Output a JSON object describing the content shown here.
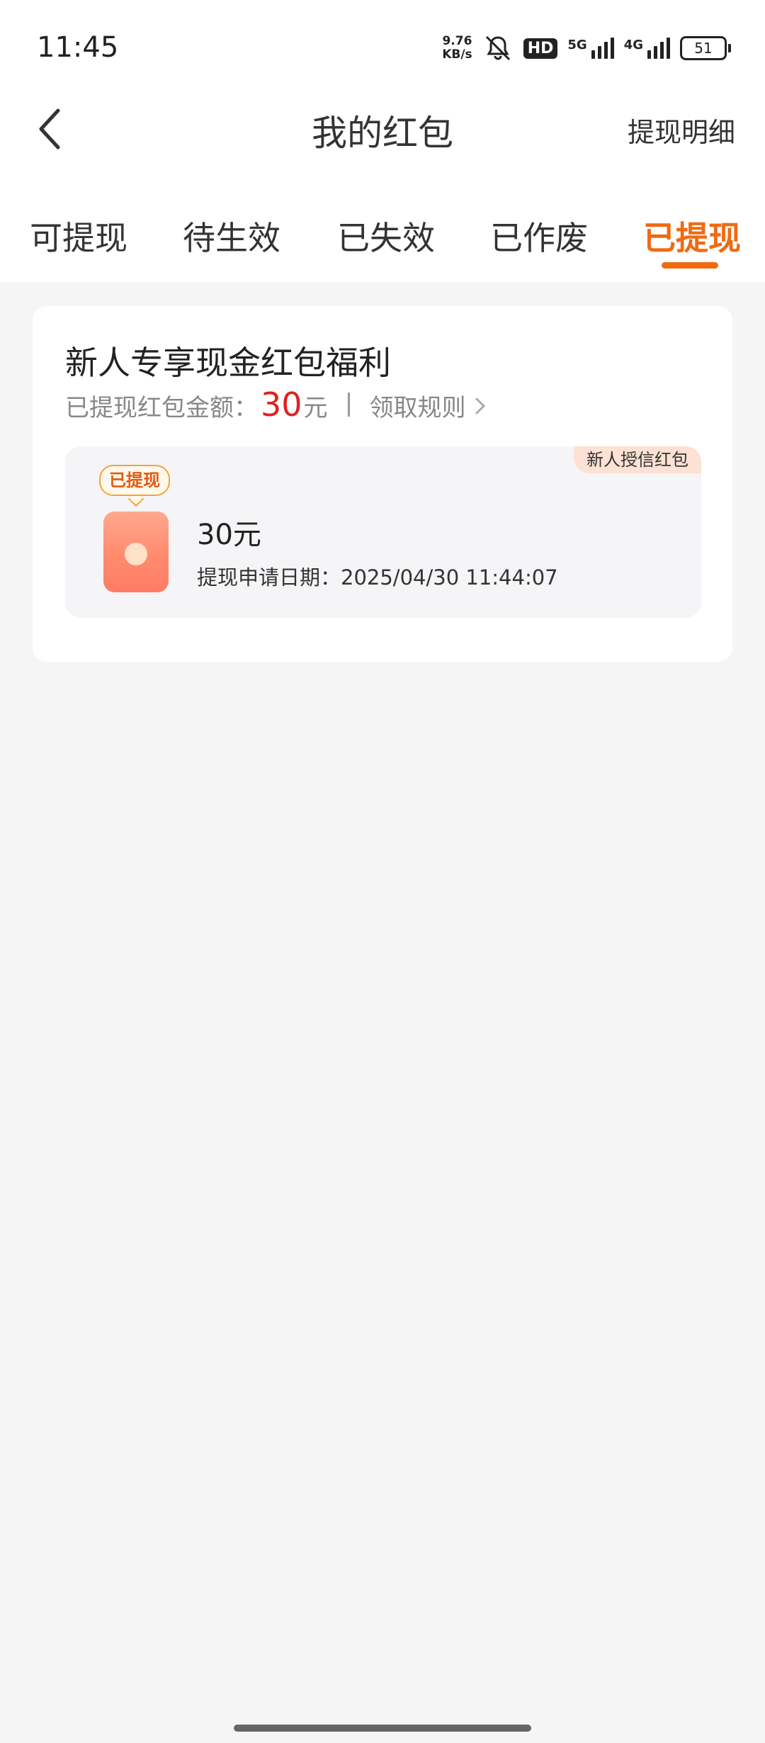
{
  "status_bar": {
    "time": "11:45",
    "net_speed_value": "9.76",
    "net_speed_unit": "KB/s",
    "hd_badge": "HD",
    "signal_1_label": "5G",
    "signal_2_label": "4G",
    "battery_level": "51",
    "icons": [
      "silent-bell-icon",
      "signal-icon",
      "battery-icon"
    ]
  },
  "header": {
    "back_icon": "chevron-left-icon",
    "title": "我的红包",
    "detail_link": "提现明细"
  },
  "tabs": [
    {
      "label": "可提现",
      "active": false
    },
    {
      "label": "待生效",
      "active": false
    },
    {
      "label": "已失效",
      "active": false
    },
    {
      "label": "已作废",
      "active": false
    },
    {
      "label": "已提现",
      "active": true
    }
  ],
  "accent_color": "#f06a12",
  "card": {
    "title": "新人专享现金红包福利",
    "summary_label": "已提现红包金额：",
    "summary_amount": "30",
    "summary_unit": "元",
    "rules_link": "领取规则",
    "packet": {
      "type_tag": "新人授信红包",
      "status": "已提现",
      "amount": "30元",
      "date_line": "提现申请日期：2025/04/30 11:44:07"
    }
  }
}
